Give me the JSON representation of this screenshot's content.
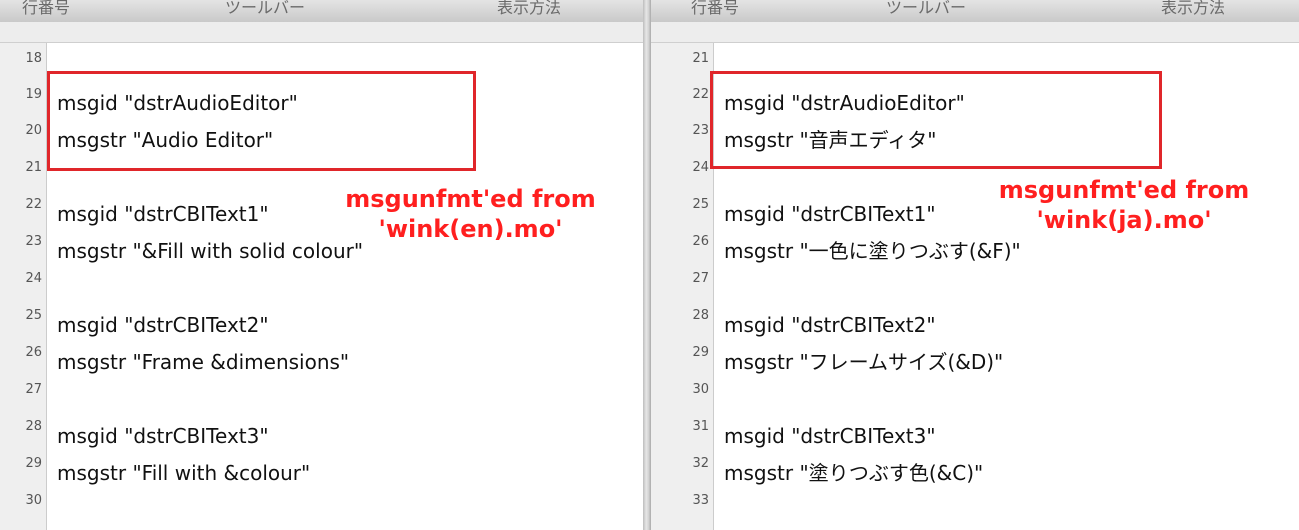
{
  "left": {
    "header_labels": [
      "行番号",
      "ツールバー",
      "表示方法"
    ],
    "lines": [
      {
        "num": "18",
        "text": ""
      },
      {
        "num": "19",
        "text": "msgid \"dstrAudioEditor\""
      },
      {
        "num": "20",
        "text": "msgstr \"Audio Editor\""
      },
      {
        "num": "21",
        "text": ""
      },
      {
        "num": "22",
        "text": "msgid \"dstrCBIText1\""
      },
      {
        "num": "23",
        "text": "msgstr \"&Fill with solid colour\""
      },
      {
        "num": "24",
        "text": ""
      },
      {
        "num": "25",
        "text": "msgid \"dstrCBIText2\""
      },
      {
        "num": "26",
        "text": "msgstr \"Frame &dimensions\""
      },
      {
        "num": "27",
        "text": ""
      },
      {
        "num": "28",
        "text": "msgid \"dstrCBIText3\""
      },
      {
        "num": "29",
        "text": "msgstr \"Fill with &colour\""
      },
      {
        "num": "30",
        "text": ""
      }
    ],
    "annotation": [
      "msgunfmt'ed from",
      "'wink(en).mo'"
    ]
  },
  "right": {
    "header_labels": [
      "行番号",
      "ツールバー",
      "表示方法"
    ],
    "lines": [
      {
        "num": "21",
        "text": ""
      },
      {
        "num": "22",
        "text": "msgid \"dstrAudioEditor\""
      },
      {
        "num": "23",
        "text": "msgstr \"音声エディタ\""
      },
      {
        "num": "24",
        "text": ""
      },
      {
        "num": "25",
        "text": "msgid \"dstrCBIText1\""
      },
      {
        "num": "26",
        "text": "msgstr \"一色に塗りつぶす(&F)\""
      },
      {
        "num": "27",
        "text": ""
      },
      {
        "num": "28",
        "text": "msgid \"dstrCBIText2\""
      },
      {
        "num": "29",
        "text": "msgstr \"フレームサイズ(&D)\""
      },
      {
        "num": "30",
        "text": ""
      },
      {
        "num": "31",
        "text": "msgid \"dstrCBIText3\""
      },
      {
        "num": "32",
        "text": "msgstr \"塗りつぶす色(&C)\""
      },
      {
        "num": "33",
        "text": ""
      }
    ],
    "annotation": [
      "msgunfmt'ed from",
      "'wink(ja).mo'"
    ]
  },
  "colors": {
    "highlight": "#e0262a",
    "annotation": "#ff1f1f"
  }
}
